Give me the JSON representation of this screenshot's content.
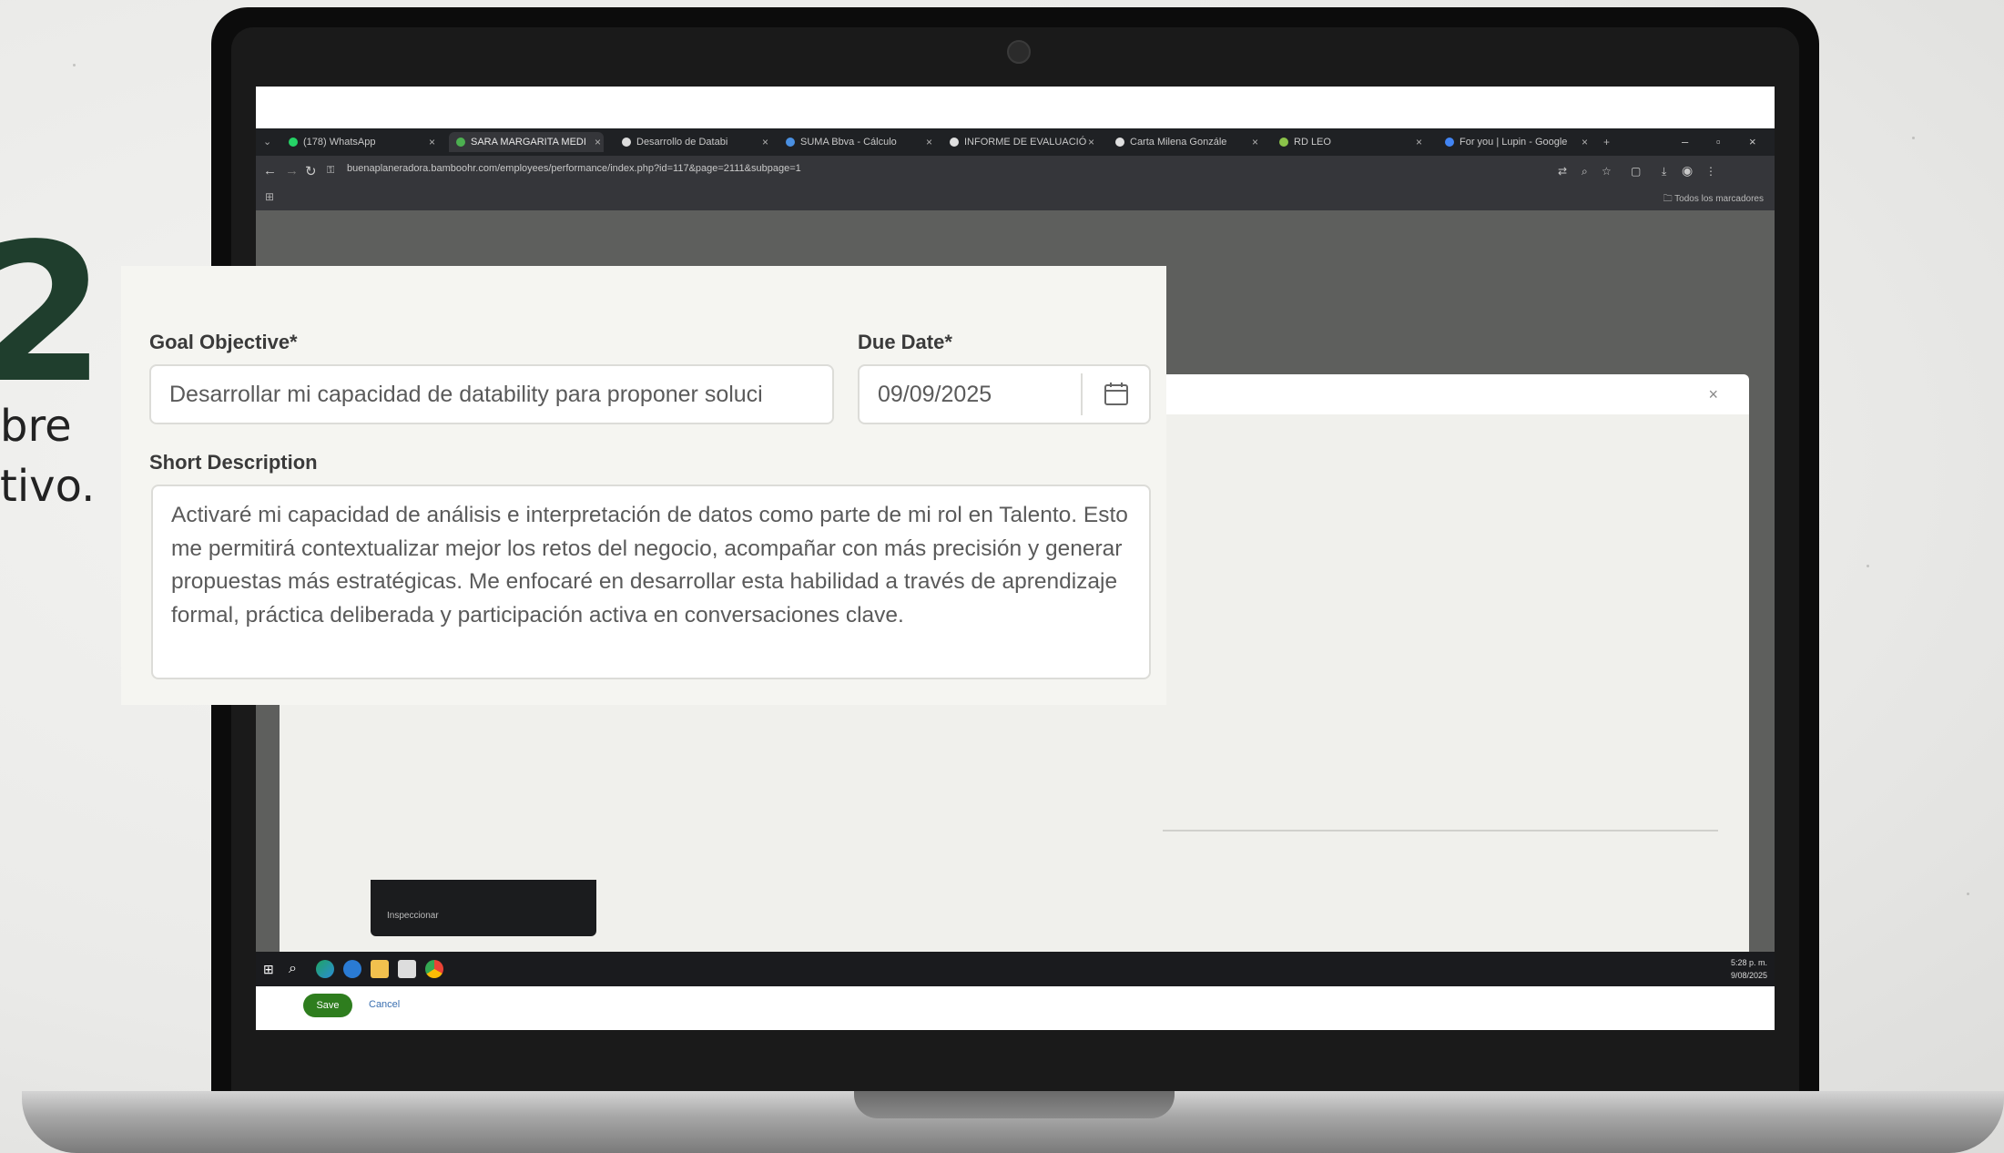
{
  "slide": {
    "step_number": "2",
    "side_text_line1": "bre",
    "side_text_line2": "tivo."
  },
  "browser": {
    "tabs": [
      {
        "label": "(178) WhatsApp",
        "color": "#25d366"
      },
      {
        "label": "SARA MARGARITA MEDI",
        "color": "#4caf50"
      },
      {
        "label": "Desarrollo de Databi",
        "color": "#dddddd"
      },
      {
        "label": "SUMA Bbva - Cálculo",
        "color": "#4a90e2"
      },
      {
        "label": "INFORME DE EVALUACIÓ",
        "color": "#e0e0e0"
      },
      {
        "label": "Carta Milena Gonzále",
        "color": "#e0e0e0"
      },
      {
        "label": "RD LEO",
        "color": "#8bc34a"
      },
      {
        "label": "For you | Lupin - Google",
        "color": "#4285f4"
      }
    ],
    "url": "buenaplaneradora.bamboohr.com/employees/performance/index.php?id=117&page=2111&subpage=1",
    "bookmarks_label": "Todos los marcadores",
    "modal_close": "×"
  },
  "dropdown": {
    "option": "Inspeccionar"
  },
  "actions": {
    "save_label": "Save",
    "cancel_label": "Cancel"
  },
  "taskbar": {
    "time": "5:28 p. m.",
    "date": "9/08/2025"
  },
  "form": {
    "goal_label": "Goal Objective*",
    "goal_value": "Desarrollar mi capacidad de datability para proponer soluci",
    "due_label": "Due Date*",
    "due_value": "09/09/2025",
    "desc_label": "Short Description",
    "desc_value": "Activaré mi capacidad de análisis e interpretación de datos como parte de mi rol en Talento. Esto me permitirá contextualizar mejor los retos del negocio, acompañar con más precisión y generar propuestas más estratégicas. Me enfocaré en desarrollar esta habilidad a través de aprendizaje formal, práctica deliberada y participación activa en conversaciones clave."
  }
}
